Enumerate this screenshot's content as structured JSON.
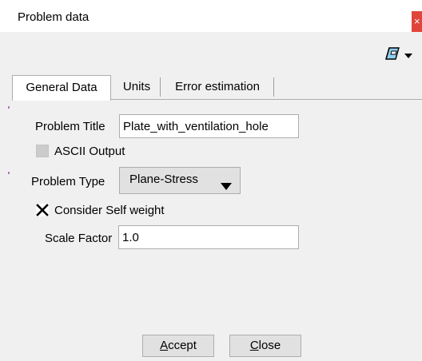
{
  "window": {
    "title": "Problem data",
    "close_glyph": "×"
  },
  "toolbar": {
    "tool_icon": "eraser-icon",
    "menu_icon": "caret-down-icon"
  },
  "tabs": [
    {
      "label": "General Data",
      "active": true
    },
    {
      "label": "Units",
      "active": false
    },
    {
      "label": "Error estimation",
      "active": false
    }
  ],
  "general": {
    "problem_title_label": "Problem Title",
    "problem_title_value": "Plate_with_ventilation_hole",
    "ascii_output_label": "ASCII Output",
    "ascii_output_checked": false,
    "ascii_output_enabled": false,
    "problem_type_label": "Problem Type",
    "problem_type_value": "Plane-Stress",
    "self_weight_label": "Consider Self weight",
    "self_weight_checked": true,
    "scale_factor_label": "Scale Factor",
    "scale_factor_value": "1.0"
  },
  "footer": {
    "accept_label": "Accept",
    "accept_mnemonic": "A",
    "accept_rest": "ccept",
    "close_label": "Close",
    "close_mnemonic": "C",
    "close_rest": "lose"
  },
  "colors": {
    "close_button": "#e0453a",
    "window_bg": "#f0f0f0",
    "field_border": "#adadad"
  }
}
